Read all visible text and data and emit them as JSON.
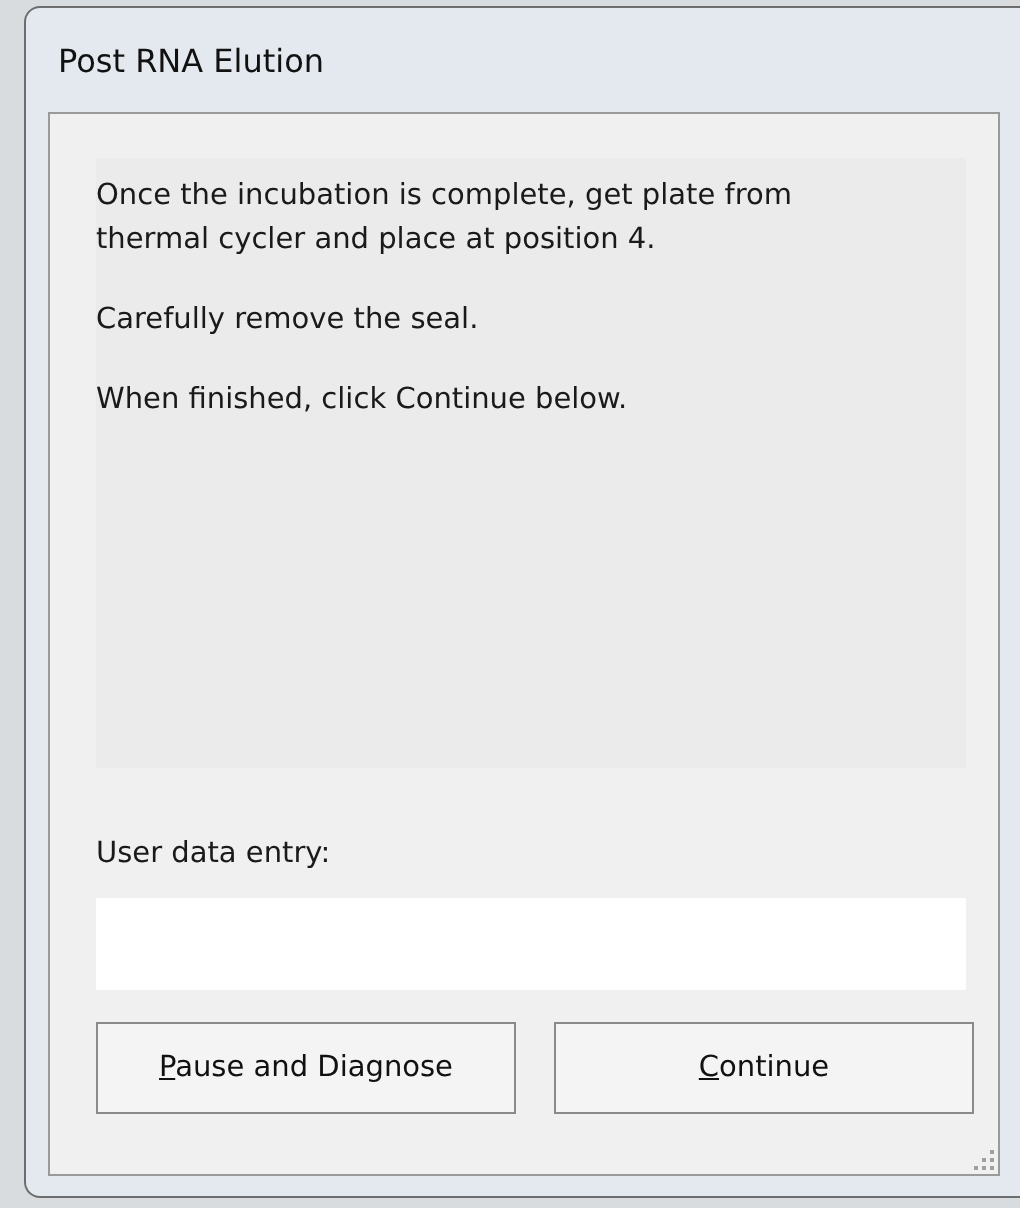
{
  "window": {
    "title": "Post RNA Elution"
  },
  "message": [
    "Once the incubation is complete, get plate from thermal cycler and place at position 4.",
    "Carefully remove the seal.",
    "When finished, click Continue below."
  ],
  "entry": {
    "label": "User data entry:"
  },
  "buttons": [
    {
      "label": "Pause and Diagnose",
      "mnemonic_first": true
    },
    {
      "label": "Continue",
      "mnemonic_first": true
    }
  ]
}
